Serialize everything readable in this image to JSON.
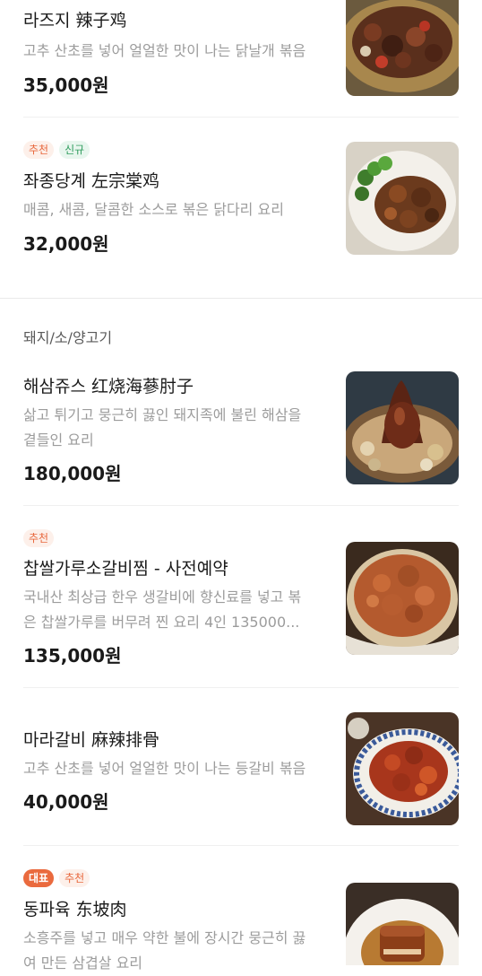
{
  "menu": {
    "items_top": [
      {
        "name": "라즈지 辣子鸡",
        "desc": "고추 산초를 넣어 얼얼한 맛이 나는 닭날개 볶음",
        "price": "35,000원",
        "image_icon": "spicy-chicken-wings-photo"
      },
      {
        "tags": [
          "추천",
          "신규"
        ],
        "name": "좌종당계 左宗棠鸡",
        "desc": "매콤, 새콤, 달콤한 소스로 볶은 닭다리 요리",
        "price": "32,000원",
        "image_icon": "general-tso-chicken-photo"
      }
    ],
    "section_title": "돼지/소/양고기",
    "items": [
      {
        "name": "해삼쥬스 红烧海蔘肘子",
        "desc_line1": "삶고 튀기고 뭉근히 끓인 돼지족에 불린 해삼을",
        "desc_line2": "곁들인 요리",
        "price": "180,000원",
        "image_icon": "braised-pork-hock-photo"
      },
      {
        "tags": [
          "추천"
        ],
        "name": "찹쌀가루소갈비찜 - 사전예약",
        "desc_line1": "국내산 최상급 한우 생갈비에 향신료를 넣고 볶",
        "desc_line2": "은 찹쌀가루를 버무려 찐 요리 4인 135000...",
        "price": "135,000원",
        "image_icon": "steamed-beef-ribs-photo"
      },
      {
        "name": "마라갈비 麻辣排骨",
        "desc": "고추 산초를 넣어 얼얼한 맛이 나는 등갈비 볶음",
        "price": "40,000원",
        "image_icon": "mala-pork-ribs-photo"
      },
      {
        "tags": [
          "대표",
          "추천"
        ],
        "name": "동파육 东坡肉",
        "desc_line1": "소흥주를 넣고 매우 약한 불에 장시간 뭉근히 끓",
        "desc_line2": "여 만든 삼겹살 요리",
        "image_icon": "dongpo-pork-photo"
      }
    ]
  }
}
